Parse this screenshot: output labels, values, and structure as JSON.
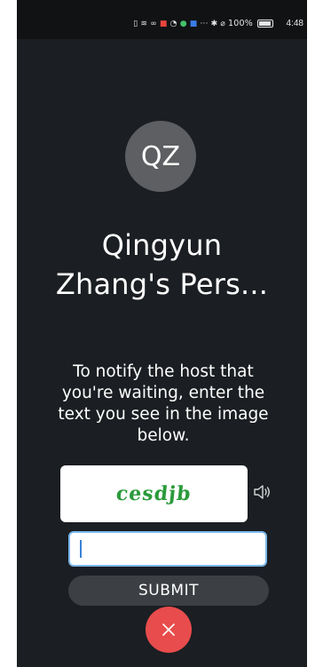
{
  "status_bar": {
    "time": "4:48",
    "battery": "100%",
    "icons": [
      "sim-icon",
      "wifi-icon",
      "infinity-icon",
      "app-notification-icon",
      "vpn-icon",
      "camera-icon",
      "app-icon",
      "more-icon",
      "bluetooth-icon",
      "mute-icon",
      "battery-icon"
    ]
  },
  "host": {
    "initials": "QZ",
    "room_title": "Qingyun Zhang's Pers..."
  },
  "instructions": "To notify the host that you're waiting, enter the text you see in the image below.",
  "captcha": {
    "text": "cesdjb",
    "input_value": "",
    "input_placeholder": ""
  },
  "buttons": {
    "submit": "SUBMIT"
  },
  "colors": {
    "background": "#1b1e22",
    "avatar": "#5d5f62",
    "captcha_text": "#2b9a3b",
    "close_button": "#e84c4c",
    "input_border": "#7ab8ec"
  }
}
